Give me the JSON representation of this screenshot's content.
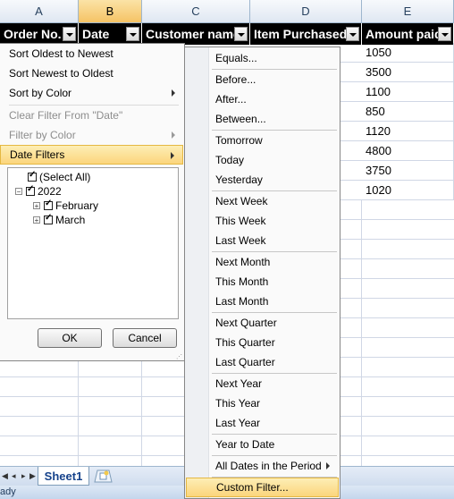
{
  "columns": [
    "A",
    "B",
    "C",
    "D",
    "E"
  ],
  "headers": {
    "order_no": "Order No.",
    "date": "Date",
    "customer_name": "Customer name",
    "item_purchased": "Item Purchased",
    "amount_paid": "Amount paid"
  },
  "amounts": [
    "1050",
    "3500",
    "1100",
    "850",
    "1120",
    "4800",
    "3750",
    "1020"
  ],
  "filter_menu": {
    "sort_oldest": "Sort Oldest to Newest",
    "sort_newest": "Sort Newest to Oldest",
    "sort_by_color": "Sort by Color",
    "clear_filter": "Clear Filter From \"Date\"",
    "filter_by_color": "Filter by Color",
    "date_filters": "Date Filters",
    "tree": {
      "select_all": "(Select All)",
      "year": "2022",
      "months": [
        "February",
        "March"
      ]
    },
    "ok": "OK",
    "cancel": "Cancel"
  },
  "date_filter_submenu": [
    "Equals...",
    "Before...",
    "After...",
    "Between...",
    "Tomorrow",
    "Today",
    "Yesterday",
    "Next Week",
    "This Week",
    "Last Week",
    "Next Month",
    "This Month",
    "Last Month",
    "Next Quarter",
    "This Quarter",
    "Last Quarter",
    "Next Year",
    "This Year",
    "Last Year",
    "Year to Date",
    "All Dates in the Period",
    "Custom Filter..."
  ],
  "sheet_tab": "Sheet1",
  "status": "ady",
  "colors": {
    "selected_column": "#f5c365",
    "highlight": "#fbd57c",
    "header_bg": "#000000"
  }
}
